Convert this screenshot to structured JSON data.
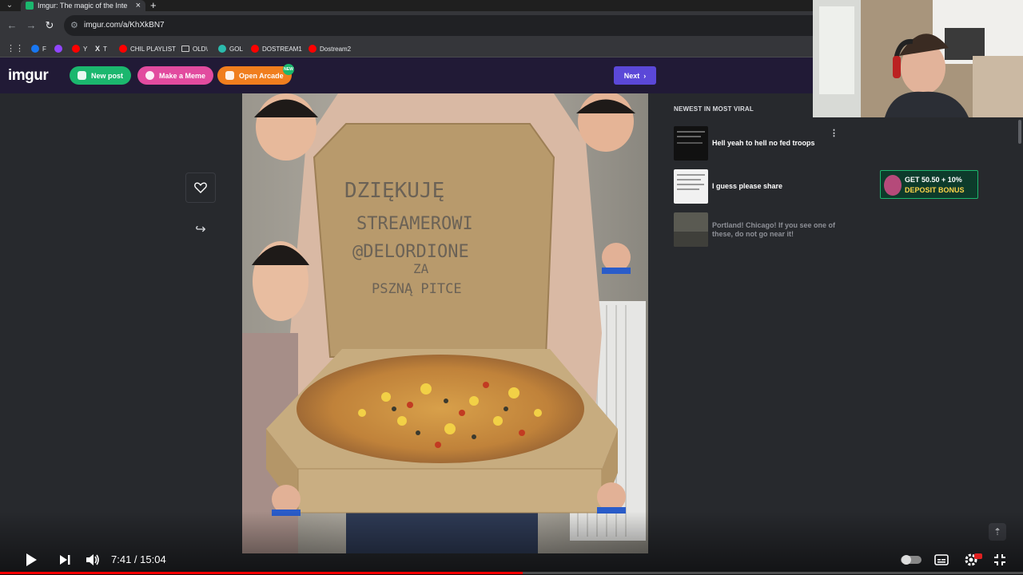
{
  "browser": {
    "tab_title": "Imgur: The magic of the Interne",
    "tab_close": "×",
    "new_tab": "+",
    "url": "imgur.com/a/KhXkBN7",
    "bookmarks": [
      {
        "label": "F",
        "color": "#1877f2"
      },
      {
        "label": "",
        "color": "#9146ff"
      },
      {
        "label": "Y",
        "color": "#ff0000"
      },
      {
        "label": "T",
        "color": "#dddddd"
      },
      {
        "label": "CHIL PLAYLIST",
        "color": "#ff0000"
      },
      {
        "label": "OLD\\",
        "color": "#cfcfcf"
      },
      {
        "label": "GOL",
        "color": "#2bbbad"
      },
      {
        "label": "DOSTREAM1",
        "color": "#ff0000"
      },
      {
        "label": "Dostream2",
        "color": "#ff0000"
      }
    ]
  },
  "imgur": {
    "logo": "imgur",
    "new_post": "New post",
    "make_meme": "Make a Meme",
    "open_arcade": "Open Arcade",
    "new_badge": "NEW",
    "next": "Next"
  },
  "sidebar": {
    "title": "NEWEST IN MOST VIRAL",
    "items": [
      {
        "label": "Hell yeah to hell no fed troops"
      },
      {
        "label": "I guess please share"
      },
      {
        "label": "Portland! Chicago! If you see one of these, do not go near it!"
      }
    ]
  },
  "ad": {
    "line1": "GET 50.50 + 10%",
    "line2": "DEPOSIT BONUS"
  },
  "post_image": {
    "text_lines": [
      "DZIĘKUJĘ",
      "STREAMEROWI",
      "@DELORDIONE",
      "ZA",
      "PSZNĄ PITCE"
    ]
  },
  "player": {
    "time": "7:41 / 15:04",
    "progress": 0.511
  },
  "colors": {
    "accent_green": "#1bb76e",
    "accent_pink": "#e24b9f",
    "accent_orange": "#f07e1e",
    "accent_purple": "#5b48d8",
    "header_bg": "#211a36",
    "page_bg": "#27292d"
  },
  "icons": {
    "favorite": "heart-icon",
    "share": "share-arrow-icon",
    "scroll_top": "arrow-up-icon"
  }
}
